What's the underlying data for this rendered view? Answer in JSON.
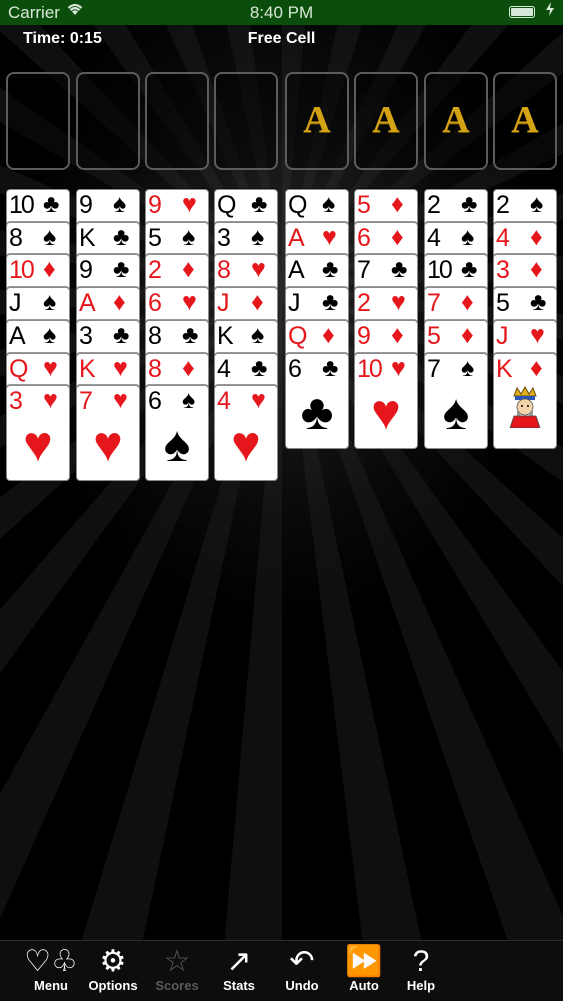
{
  "status": {
    "carrier": "Carrier",
    "time": "8:40 PM",
    "battery_level": 1.0
  },
  "header": {
    "time_label": "Time: 0:15",
    "title": "Free Cell"
  },
  "free_cells": [
    {
      "card": ""
    },
    {
      "card": ""
    },
    {
      "card": ""
    },
    {
      "card": ""
    }
  ],
  "foundations": [
    {
      "card": "A"
    },
    {
      "card": "A"
    },
    {
      "card": "A"
    },
    {
      "card": "A"
    }
  ],
  "suits": {
    "clubs": "♣",
    "spades": "♠",
    "hearts": "♥",
    "diamonds": "♦"
  },
  "colors": {
    "red": "#e6171c",
    "black": "#000000",
    "ace_gold": "#d4a316",
    "status_bar": "#0b4e0b"
  },
  "tableau": [
    [
      {
        "rank": "10",
        "suit": "clubs"
      },
      {
        "rank": "8",
        "suit": "spades"
      },
      {
        "rank": "10",
        "suit": "diamonds"
      },
      {
        "rank": "J",
        "suit": "spades"
      },
      {
        "rank": "A",
        "suit": "spades"
      },
      {
        "rank": "Q",
        "suit": "hearts"
      },
      {
        "rank": "3",
        "suit": "hearts"
      }
    ],
    [
      {
        "rank": "9",
        "suit": "spades"
      },
      {
        "rank": "K",
        "suit": "clubs"
      },
      {
        "rank": "9",
        "suit": "clubs"
      },
      {
        "rank": "A",
        "suit": "diamonds"
      },
      {
        "rank": "3",
        "suit": "clubs"
      },
      {
        "rank": "K",
        "suit": "hearts"
      },
      {
        "rank": "7",
        "suit": "hearts"
      }
    ],
    [
      {
        "rank": "9",
        "suit": "hearts"
      },
      {
        "rank": "5",
        "suit": "spades"
      },
      {
        "rank": "2",
        "suit": "diamonds"
      },
      {
        "rank": "6",
        "suit": "hearts"
      },
      {
        "rank": "8",
        "suit": "clubs"
      },
      {
        "rank": "8",
        "suit": "diamonds"
      },
      {
        "rank": "6",
        "suit": "spades"
      }
    ],
    [
      {
        "rank": "Q",
        "suit": "clubs"
      },
      {
        "rank": "3",
        "suit": "spades"
      },
      {
        "rank": "8",
        "suit": "hearts"
      },
      {
        "rank": "J",
        "suit": "diamonds"
      },
      {
        "rank": "K",
        "suit": "spades"
      },
      {
        "rank": "4",
        "suit": "clubs"
      },
      {
        "rank": "4",
        "suit": "hearts"
      }
    ],
    [
      {
        "rank": "Q",
        "suit": "spades"
      },
      {
        "rank": "A",
        "suit": "hearts"
      },
      {
        "rank": "A",
        "suit": "clubs"
      },
      {
        "rank": "J",
        "suit": "clubs"
      },
      {
        "rank": "Q",
        "suit": "diamonds"
      },
      {
        "rank": "6",
        "suit": "clubs"
      }
    ],
    [
      {
        "rank": "5",
        "suit": "diamonds"
      },
      {
        "rank": "6",
        "suit": "diamonds"
      },
      {
        "rank": "7",
        "suit": "clubs"
      },
      {
        "rank": "2",
        "suit": "hearts"
      },
      {
        "rank": "9",
        "suit": "diamonds"
      },
      {
        "rank": "10",
        "suit": "hearts"
      }
    ],
    [
      {
        "rank": "2",
        "suit": "clubs"
      },
      {
        "rank": "4",
        "suit": "spades"
      },
      {
        "rank": "10",
        "suit": "clubs"
      },
      {
        "rank": "7",
        "suit": "diamonds"
      },
      {
        "rank": "5",
        "suit": "diamonds"
      },
      {
        "rank": "7",
        "suit": "spades"
      }
    ],
    [
      {
        "rank": "2",
        "suit": "spades"
      },
      {
        "rank": "4",
        "suit": "diamonds"
      },
      {
        "rank": "3",
        "suit": "diamonds"
      },
      {
        "rank": "5",
        "suit": "clubs"
      },
      {
        "rank": "J",
        "suit": "hearts"
      },
      {
        "rank": "K",
        "suit": "diamonds"
      }
    ]
  ],
  "toolbar": [
    {
      "label": "Menu",
      "icon": "card-suits-icon",
      "glyph": "♡♧",
      "enabled": true
    },
    {
      "label": "Options",
      "icon": "gears-icon",
      "glyph": "⚙",
      "enabled": true
    },
    {
      "label": "Scores",
      "icon": "star-icon",
      "glyph": "☆",
      "enabled": false
    },
    {
      "label": "Stats",
      "icon": "stats-graph-icon",
      "glyph": "↗",
      "enabled": true
    },
    {
      "label": "Undo",
      "icon": "undo-icon",
      "glyph": "↶",
      "enabled": true
    },
    {
      "label": "Auto",
      "icon": "fast-forward-icon",
      "glyph": "⏩",
      "enabled": true
    },
    {
      "label": "Help",
      "icon": "help-icon",
      "glyph": "?",
      "enabled": true
    }
  ]
}
